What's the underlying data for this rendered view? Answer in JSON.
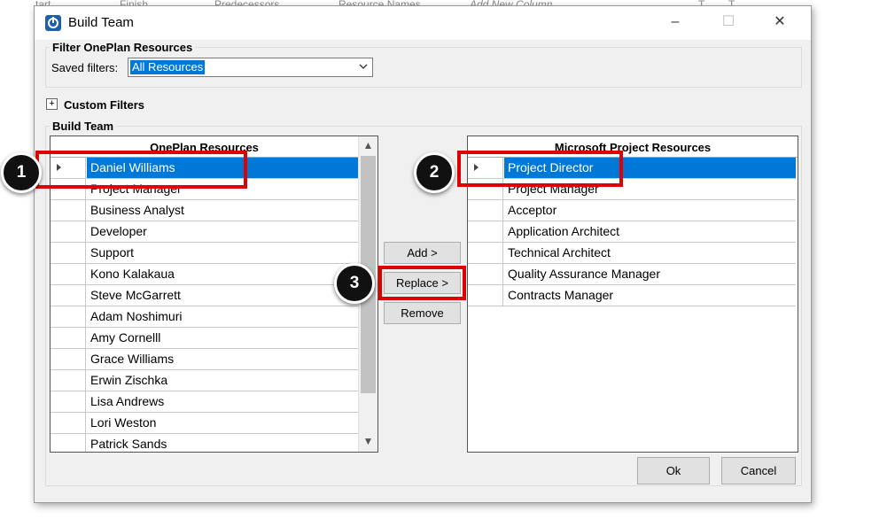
{
  "background": {
    "columns": [
      "tart",
      "Finish",
      "Predecessors",
      "Resource Names",
      "Add New Column",
      "T",
      "T"
    ]
  },
  "dialog": {
    "title": "Build Team",
    "controls": {
      "minimize": "–",
      "maximize": "☐",
      "close": "✕"
    }
  },
  "filter": {
    "group_label": "Filter OnePlan Resources",
    "saved_label": "Saved filters:",
    "saved_value": "All Resources"
  },
  "custom_filters": {
    "expander": "+",
    "label": "Custom Filters"
  },
  "build_team": {
    "group_label": "Build Team",
    "left_grid": {
      "header": "OnePlan Resources",
      "selected_index": 0,
      "rows": [
        "Daniel Williams",
        "Project Manager",
        "Business Analyst",
        "Developer",
        "Support",
        "Kono Kalakaua",
        "Steve McGarrett",
        "Adam Noshimuri",
        "Amy Cornelll",
        "Grace Williams",
        "Erwin Zischka",
        "Lisa Andrews",
        "Lori Weston",
        "Patrick Sands"
      ]
    },
    "right_grid": {
      "header": "Microsoft Project Resources",
      "selected_index": 0,
      "rows": [
        "Project Director",
        "Project Manager",
        "Acceptor",
        "Application Architect",
        "Technical Architect",
        "Quality Assurance Manager",
        "Contracts Manager"
      ]
    },
    "actions": {
      "add": "Add >",
      "replace": "Replace >",
      "remove": "Remove"
    }
  },
  "footer": {
    "ok": "Ok",
    "cancel": "Cancel"
  },
  "callouts": [
    "1",
    "2",
    "3"
  ],
  "colors": {
    "selection": "#0078d7",
    "callout_border": "#e00000",
    "badge": "#111111"
  }
}
